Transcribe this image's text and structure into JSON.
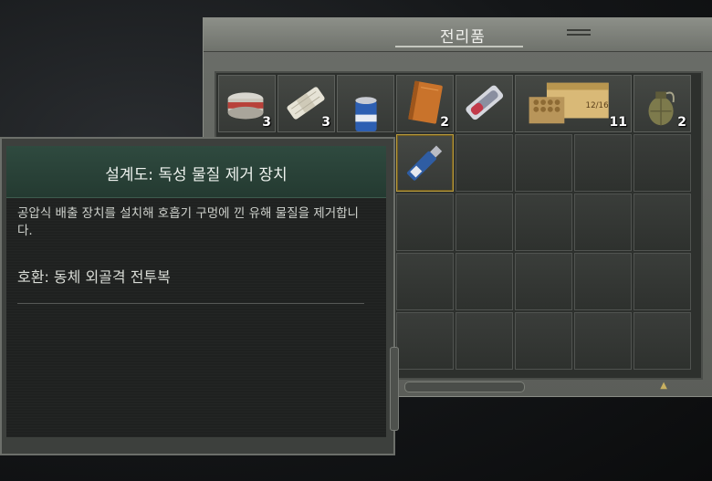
{
  "loot_window": {
    "title": "전리품",
    "items": [
      {
        "name": "canned-food",
        "icon": "tin-can-icon",
        "quantity": "3"
      },
      {
        "name": "bandage",
        "icon": "bandage-roll-icon",
        "quantity": "3"
      },
      {
        "name": "energy-drink",
        "icon": "soda-can-icon",
        "quantity": ""
      },
      {
        "name": "book",
        "icon": "book-icon",
        "quantity": "2"
      },
      {
        "name": "blister-pack",
        "icon": "pill-pack-icon",
        "quantity": ""
      },
      {
        "name": "ammo-box",
        "icon": "ammo-box-icon",
        "quantity": "11"
      },
      {
        "name": "grenade",
        "icon": "grenade-icon",
        "quantity": "2"
      },
      {
        "name": "blueprint-usb",
        "icon": "usb-drive-icon",
        "quantity": ""
      }
    ],
    "ammo_box_label": "12/16"
  },
  "tooltip": {
    "title": "설계도:  독성 물질 제거 장치",
    "description": "공압식 배출 장치를 설치해 호흡기 구멍에 낀 유해 물질을 제거합니다.",
    "compatibility": "호환: 동체 외골격 전투복"
  },
  "colors": {
    "tooltip_header": "#2f4a3f",
    "selected_border": "#b89a3c",
    "panel_frame": "#6b6e69"
  }
}
